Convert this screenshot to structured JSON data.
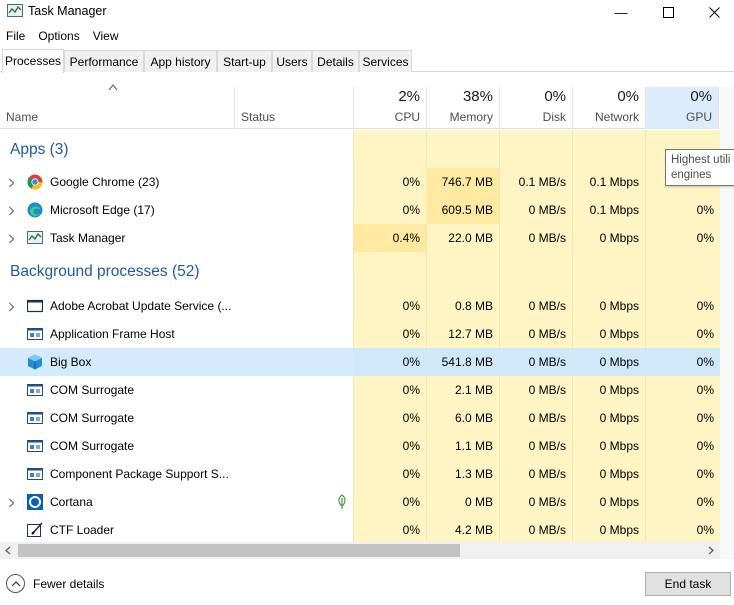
{
  "window": {
    "title": "Task Manager",
    "minimize_glyph": "—",
    "maximize_glyph": "☐",
    "close_glyph": "✕"
  },
  "menu": [
    "File",
    "Options",
    "View"
  ],
  "tabs": [
    "Processes",
    "Performance",
    "App history",
    "Start-up",
    "Users",
    "Details",
    "Services"
  ],
  "columns": {
    "name": "Name",
    "status": "Status",
    "cpu": {
      "pct": "2%",
      "label": "CPU"
    },
    "memory": {
      "pct": "38%",
      "label": "Memory"
    },
    "disk": {
      "pct": "0%",
      "label": "Disk"
    },
    "network": {
      "pct": "0%",
      "label": "Network"
    },
    "gpu": {
      "pct": "0%",
      "label": "GPU"
    },
    "gpu_engine_partial": "G"
  },
  "groups": {
    "apps": "Apps (3)",
    "background": "Background processes (52)"
  },
  "apps": [
    {
      "name": "Google Chrome (23)",
      "icon": "chrome-icon",
      "cpu": "0%",
      "memory": "746.7 MB",
      "disk": "0.1 MB/s",
      "network": "0.1 Mbps",
      "gpu": ""
    },
    {
      "name": "Microsoft Edge (17)",
      "icon": "edge-icon",
      "cpu": "0%",
      "memory": "609.5 MB",
      "disk": "0 MB/s",
      "network": "0.1 Mbps",
      "gpu": "0%"
    },
    {
      "name": "Task Manager",
      "icon": "task-manager-icon",
      "cpu": "0.4%",
      "memory": "22.0 MB",
      "disk": "0 MB/s",
      "network": "0 Mbps",
      "gpu": "0%"
    }
  ],
  "background": [
    {
      "name": "Adobe Acrobat Update Service (...",
      "icon": "window-icon",
      "expand": true,
      "cpu": "0%",
      "memory": "0.8 MB",
      "disk": "0 MB/s",
      "network": "0 Mbps",
      "gpu": "0%"
    },
    {
      "name": "Application Frame Host",
      "icon": "service-icon",
      "expand": false,
      "cpu": "0%",
      "memory": "12.7 MB",
      "disk": "0 MB/s",
      "network": "0 Mbps",
      "gpu": "0%"
    },
    {
      "name": "Big Box",
      "icon": "box-icon",
      "expand": false,
      "selected": true,
      "cpu": "0%",
      "memory": "541.8 MB",
      "disk": "0 MB/s",
      "network": "0 Mbps",
      "gpu": "0%"
    },
    {
      "name": "COM Surrogate",
      "icon": "service-icon",
      "expand": false,
      "cpu": "0%",
      "memory": "2.1 MB",
      "disk": "0 MB/s",
      "network": "0 Mbps",
      "gpu": "0%"
    },
    {
      "name": "COM Surrogate",
      "icon": "service-icon",
      "expand": false,
      "cpu": "0%",
      "memory": "6.0 MB",
      "disk": "0 MB/s",
      "network": "0 Mbps",
      "gpu": "0%"
    },
    {
      "name": "COM Surrogate",
      "icon": "service-icon",
      "expand": false,
      "cpu": "0%",
      "memory": "1.1 MB",
      "disk": "0 MB/s",
      "network": "0 Mbps",
      "gpu": "0%"
    },
    {
      "name": "Component Package Support S...",
      "icon": "service-icon",
      "expand": false,
      "cpu": "0%",
      "memory": "1.3 MB",
      "disk": "0 MB/s",
      "network": "0 Mbps",
      "gpu": "0%"
    },
    {
      "name": "Cortana",
      "icon": "cortana-icon",
      "expand": true,
      "suspended": true,
      "cpu": "0%",
      "memory": "0 MB",
      "disk": "0 MB/s",
      "network": "0 Mbps",
      "gpu": "0%"
    },
    {
      "name": "CTF Loader",
      "icon": "ctf-icon",
      "expand": false,
      "cpu": "0%",
      "memory": "4.2 MB",
      "disk": "0 MB/s",
      "network": "0 Mbps",
      "gpu": "0%"
    }
  ],
  "tooltip": {
    "line1": "Highest utili",
    "line2": "engines"
  },
  "footer": {
    "fewer_details": "Fewer details",
    "end_task": "End task"
  },
  "colors": {
    "group_title": "#1e5aa8",
    "heat_light": "#fff4c4",
    "heat_medium": "#ffe9a0",
    "selected_row": "#cce8ff",
    "gpu_header": "#dcecfc"
  }
}
